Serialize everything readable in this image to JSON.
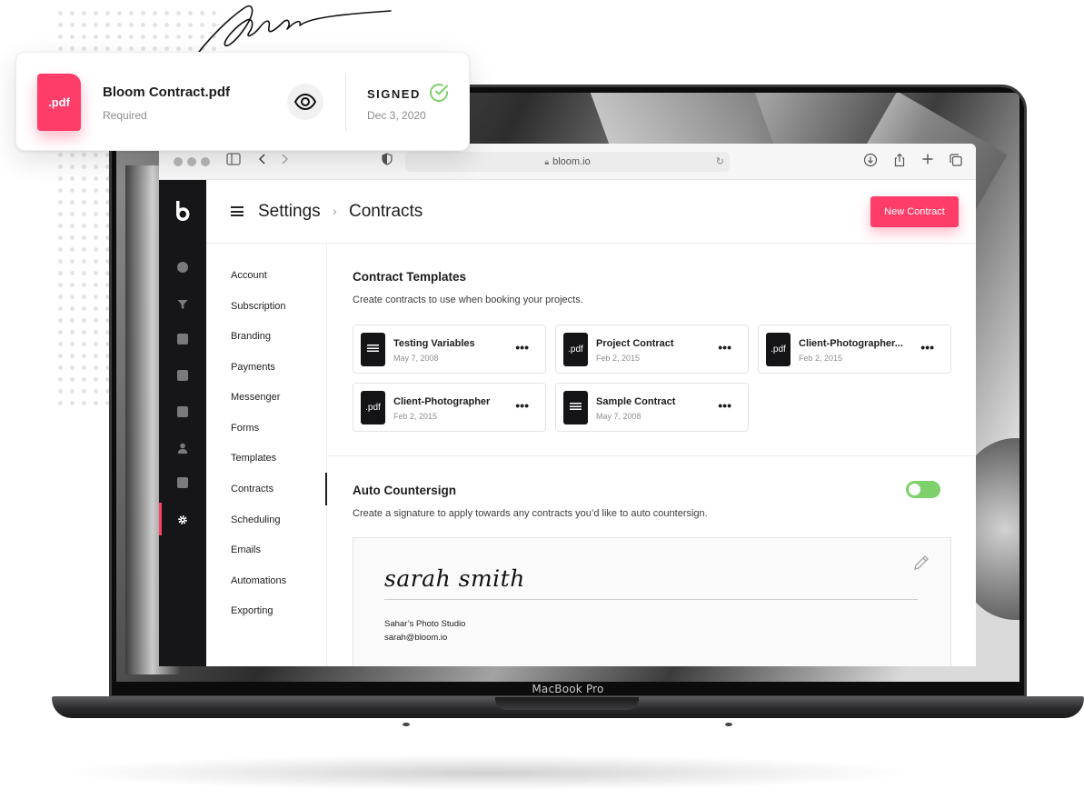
{
  "floating_card": {
    "file_icon_label": ".pdf",
    "file_name": "Bloom Contract.pdf",
    "file_status": "Required",
    "sign_state": "SIGNED",
    "sign_date": "Dec 3, 2020",
    "icons": [
      "eye-icon",
      "check-circle-icon"
    ],
    "colors": {
      "accent": "#ff3d68",
      "success": "#7ed06a"
    }
  },
  "device": {
    "label": "MacBook Pro"
  },
  "browser": {
    "url": "bloom.io"
  },
  "header": {
    "crumb_root": "Settings",
    "crumb_separator": "›",
    "crumb_current": "Contracts",
    "new_contract_label": "New Contract"
  },
  "settings_nav": {
    "items": [
      "Account",
      "Subscription",
      "Branding",
      "Payments",
      "Messenger",
      "Forms",
      "Templates",
      "Contracts",
      "Scheduling",
      "Emails",
      "Automations",
      "Exporting"
    ],
    "active": "Contracts"
  },
  "templates": {
    "title": "Contract Templates",
    "description": "Create contracts to use when booking your projects.",
    "cards": [
      {
        "icon": "document-icon",
        "title": "Testing Variables",
        "date": "May 7, 2008"
      },
      {
        "icon": ".pdf",
        "title": "Project Contract",
        "date": "Feb 2, 2015"
      },
      {
        "icon": ".pdf",
        "title": "Client-Photographer...",
        "date": "Feb 2, 2015"
      },
      {
        "icon": ".pdf",
        "title": "Client-Photographer",
        "date": "Feb 2, 2015"
      },
      {
        "icon": "document-icon",
        "title": "Sample Contract",
        "date": "May 7, 2008"
      }
    ],
    "more_label": "•••"
  },
  "countersign": {
    "title": "Auto Countersign",
    "description": "Create a signature to apply towards any contracts you’d like to auto countersign.",
    "enabled": true,
    "signature_text": "sarah smith",
    "studio": "Sahar’s Photo Studio",
    "email": "sarah@bloom.io"
  }
}
